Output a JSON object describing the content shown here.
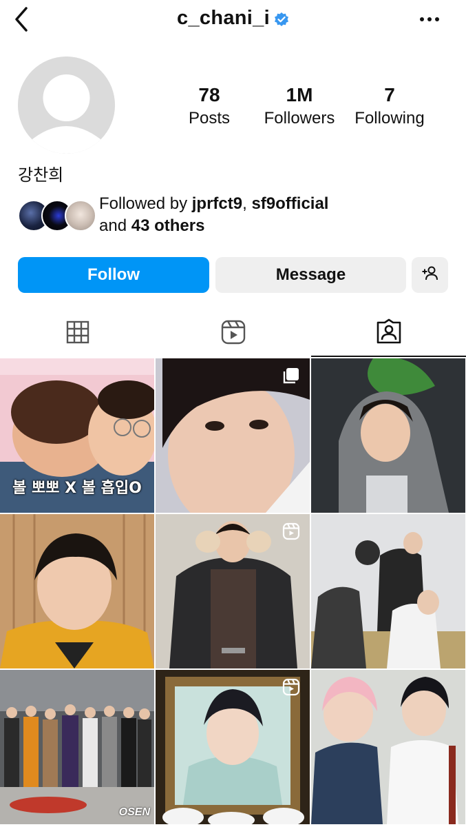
{
  "header": {
    "username": "c_chani_i",
    "verified": true,
    "back_icon": "chevron-left-icon",
    "more_icon": "ellipsis-icon"
  },
  "profile": {
    "display_name": "강찬희",
    "stats": [
      {
        "value": "78",
        "label": "Posts"
      },
      {
        "value": "1M",
        "label": "Followers"
      },
      {
        "value": "7",
        "label": "Following"
      }
    ],
    "followed_by": {
      "prefix": "Followed by ",
      "user1": "jprfct9",
      "sep": ", ",
      "user2": "sf9official",
      "and": "and ",
      "others": "43 others"
    }
  },
  "actions": {
    "follow_label": "Follow",
    "message_label": "Message",
    "add_user_icon": "add-person-icon"
  },
  "tabs": [
    {
      "name": "posts",
      "icon": "grid-icon",
      "active": false
    },
    {
      "name": "reels",
      "icon": "reels-icon",
      "active": false
    },
    {
      "name": "tagged",
      "icon": "tagged-person-icon",
      "active": true
    }
  ],
  "posts": [
    {
      "caption": "볼 뽀뽀 X 볼 흡입O",
      "badge": null
    },
    {
      "caption": "",
      "badge": "carousel"
    },
    {
      "caption": "",
      "badge": null
    },
    {
      "caption": "",
      "badge": null
    },
    {
      "caption": "",
      "badge": "reel"
    },
    {
      "caption": "",
      "badge": null
    },
    {
      "caption": "",
      "badge": null,
      "watermark": "OSEN"
    },
    {
      "caption": "",
      "badge": "reel"
    },
    {
      "caption": "",
      "badge": null
    }
  ],
  "colors": {
    "accent": "#0095f6",
    "secondary_button": "#efefef",
    "verified": "#3897f0"
  }
}
